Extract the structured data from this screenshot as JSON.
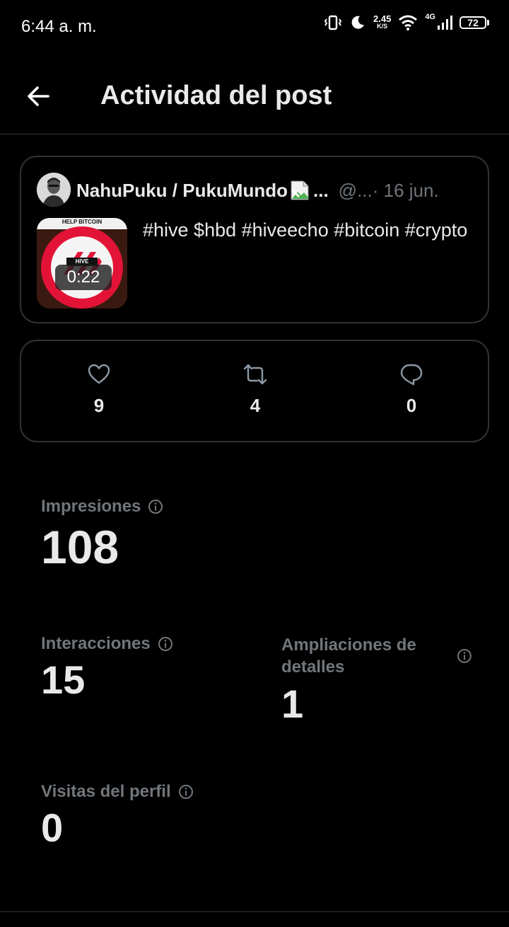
{
  "status_bar": {
    "time": "6:44 a. m.",
    "net_speed_value": "2.45",
    "net_speed_unit": "K/S",
    "network_type": "4G",
    "battery": "72"
  },
  "header": {
    "title": "Actividad del post"
  },
  "post": {
    "author": "NahuPuku / PukuMundo",
    "author_ellipsis": "...",
    "handle": "@...",
    "date": " · 16 jun.",
    "video_duration": "0:22",
    "thumbnail_banner": "HELP BITCOIN",
    "thumbnail_label": "HIVE",
    "text": "#hive $hbd #hiveecho #bitcoin #crypto"
  },
  "engagement": {
    "likes": "9",
    "reposts": "4",
    "replies": "0"
  },
  "metrics": {
    "impressions_label": "Impresiones",
    "impressions_value": "108",
    "interactions_label": "Interacciones",
    "interactions_value": "15",
    "detail_expands_label": "Ampliaciones de detalles",
    "detail_expands_value": "1",
    "profile_visits_label": "Visitas del perfil",
    "profile_visits_value": "0"
  },
  "icons": {
    "back": "arrow-left-icon",
    "like": "heart-icon",
    "repost": "repost-icon",
    "reply": "reply-bubble-icon",
    "info": "info-icon"
  },
  "colors": {
    "background": "#000000",
    "text": "#e7e9ea",
    "muted": "#71767b",
    "border": "#2f3336",
    "hive_red": "#e31337"
  }
}
